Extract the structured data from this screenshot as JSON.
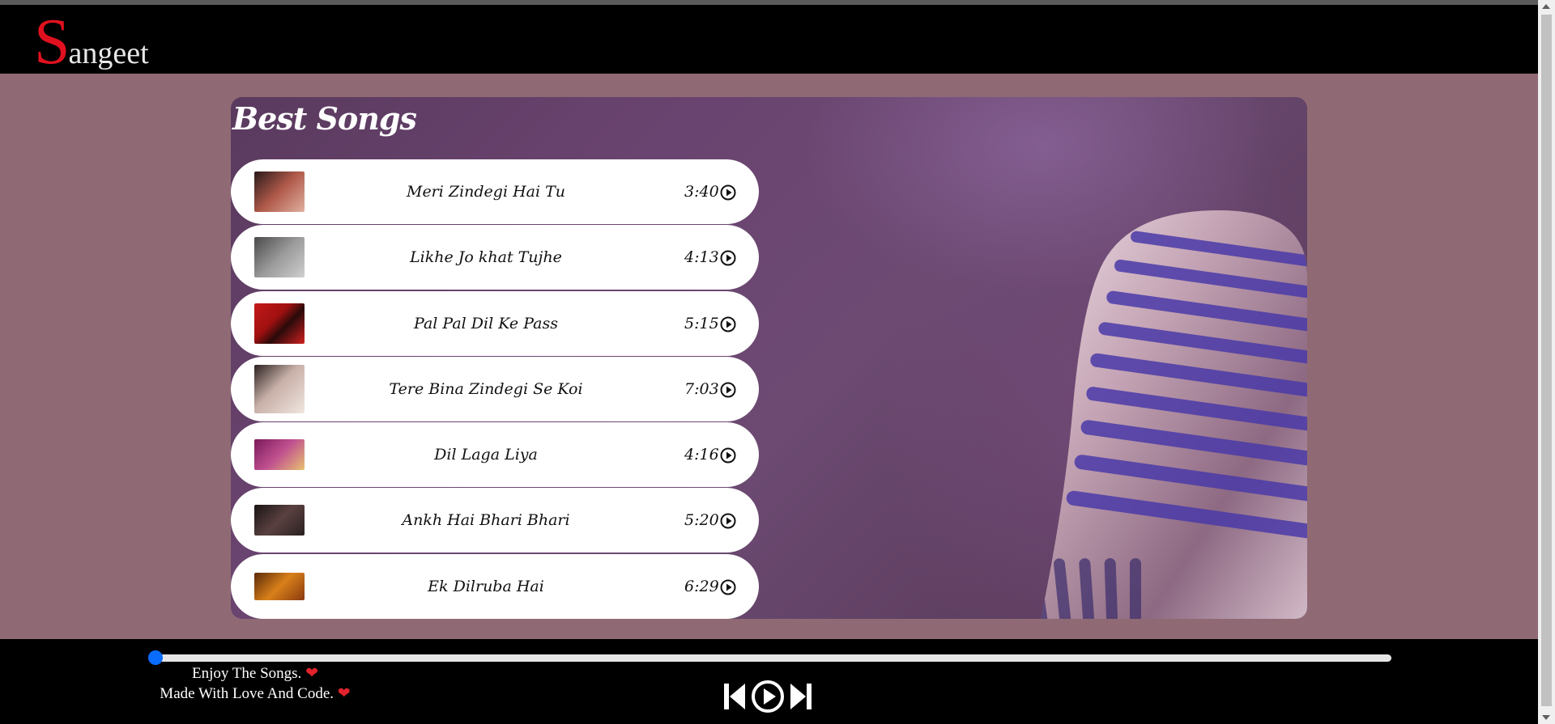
{
  "brand": {
    "first_letter": "S",
    "rest": "angeet"
  },
  "section_title": "Best Songs",
  "songs": [
    {
      "name": "Meri Zindegi Hai Tu",
      "duration": "3:40",
      "thumb_color": "#8b3a2e"
    },
    {
      "name": "Likhe Jo khat Tujhe",
      "duration": "4:13",
      "thumb_color": "#7c7c7c"
    },
    {
      "name": "Pal Pal Dil Ke Pass",
      "duration": "5:15",
      "thumb_color": "#c41a1a"
    },
    {
      "name": "Tere Bina Zindegi Se Koi",
      "duration": "7:03",
      "thumb_color": "#b8a8a0"
    },
    {
      "name": "Dil Laga Liya",
      "duration": "4:16",
      "thumb_color": "#9a2a6a"
    },
    {
      "name": "Ankh Hai Bhari Bhari",
      "duration": "5:20",
      "thumb_color": "#3a2a2a"
    },
    {
      "name": "Ek Dilruba Hai",
      "duration": "6:29",
      "thumb_color": "#b8621a"
    }
  ],
  "player": {
    "progress_percent": 0,
    "footer_line1": "Enjoy The Songs.",
    "footer_line2": "Made With Love And Code.",
    "heart": "❤"
  },
  "colors": {
    "accent": "#0a6cff",
    "brand_red": "#e0101f",
    "page_bg": "#8f6a74",
    "bars": "#000000"
  },
  "icons": [
    "play-circle-icon",
    "previous-icon",
    "play-icon",
    "next-icon",
    "microphone-image"
  ]
}
